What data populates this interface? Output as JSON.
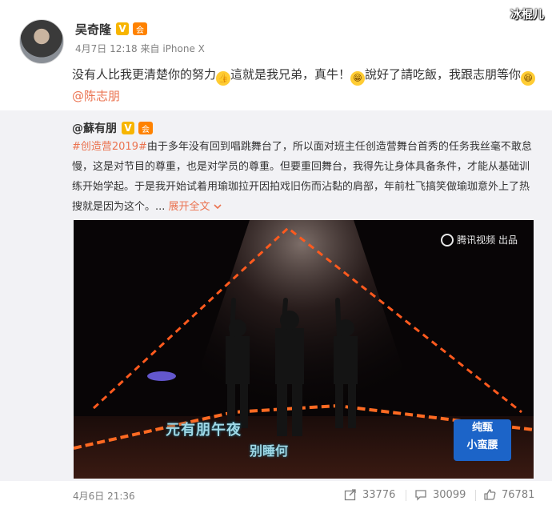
{
  "watermark": "冰棍儿",
  "post": {
    "author": "吴奇隆",
    "v_badge": "V",
    "member_badge": "会",
    "date": "4月7日 12:18",
    "source": "来自 iPhone X",
    "text_1": "没有人比我更清楚你的努力",
    "text_2": "這就是我兄弟，真牛！",
    "text_3": "說好了請吃飯，我跟志朋等你",
    "mention": "@陈志朋"
  },
  "repost": {
    "author": "@蘇有朋",
    "v_badge": "V",
    "member_badge": "会",
    "hashtag": "#创造营2019#",
    "text": "由于多年没有回到唱跳舞台了，所以面对班主任创造营舞台首秀的任务我丝毫不敢怠慢，这是对节目的尊重，也是对学员的尊重。但要重回舞台，我得先让身体具备条件，才能从基础训练开始学起。于是我开始试着用瑜珈拉开因拍戏旧伤而沾黏的肩部，年前杜飞搞笑做瑜珈意外上了热搜就是因为这个。...",
    "expand_label": "展开全文",
    "expand_icon": "chevron-down-icon"
  },
  "video": {
    "brand": "腾讯视频 出品",
    "caption_a": "元有朋午夜",
    "caption_b": "别睡何",
    "corner_line1": "纯甄",
    "corner_line2": "小蛮腰"
  },
  "footer": {
    "date": "4月6日 21:36",
    "reposts": "33776",
    "comments": "30099",
    "likes": "76781"
  }
}
